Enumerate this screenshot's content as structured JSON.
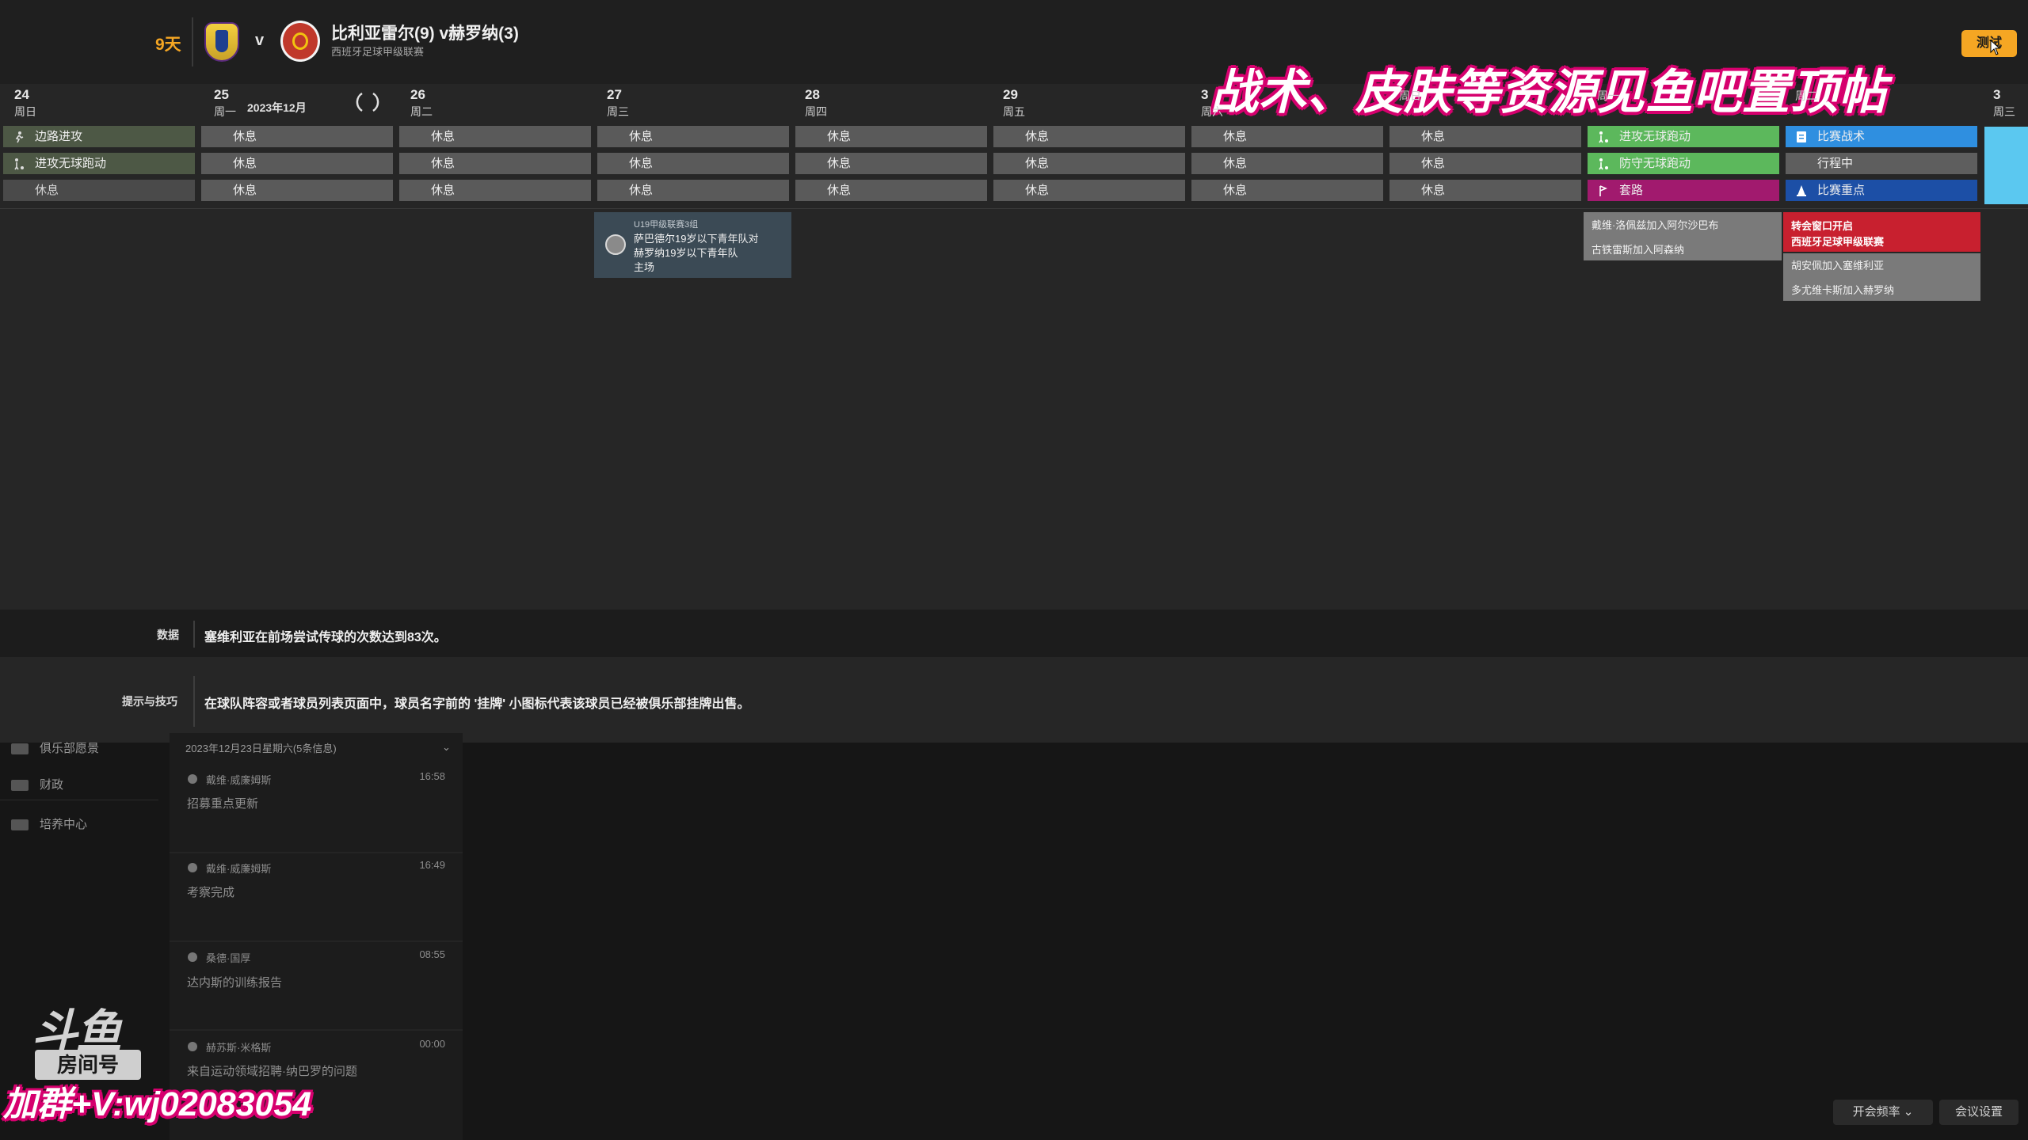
{
  "header": {
    "days_left": "9天",
    "vs": "v",
    "match_title": "比利亚雷尔(9) v赫罗纳(3)",
    "league": "西班牙足球甲级联赛",
    "continue_label": "测试"
  },
  "banner": "战术、皮肤等资源见鱼吧置顶帖",
  "calendar": {
    "month": "2023年12月",
    "days": [
      {
        "num": "24",
        "weekday": "周日"
      },
      {
        "num": "25",
        "weekday": "周一"
      },
      {
        "num": "26",
        "weekday": "周二"
      },
      {
        "num": "27",
        "weekday": "周三"
      },
      {
        "num": "28",
        "weekday": "周四"
      },
      {
        "num": "29",
        "weekday": "周五"
      },
      {
        "num": "3",
        "weekday": "周六"
      },
      {
        "num": "",
        "weekday": "周日"
      },
      {
        "num": "",
        "weekday": "周一"
      },
      {
        "num": "",
        "weekday": "周二"
      },
      {
        "num": "3",
        "weekday": "周三"
      }
    ],
    "rest": "休息",
    "first_col": [
      "边路进攻",
      "进攻无球跑动",
      "休息"
    ],
    "mon_col": [
      "进攻无球跑动",
      "防守无球跑动",
      "套路"
    ],
    "tue_col": [
      "比赛战术",
      "行程中",
      "比赛重点"
    ],
    "colors": {
      "green": "#5cb85c",
      "blue": "#2f8fe0",
      "dark_blue": "#1c4fa6",
      "purple": "#a11a6e",
      "transfer_red": "#c8202f",
      "accent": "#f5a623"
    }
  },
  "u19": {
    "title": "U19甲级联赛3组",
    "line1": "萨巴德尔19岁以下青年队对",
    "line2": "赫罗纳19岁以下青年队",
    "line3": "主场"
  },
  "news_mon": [
    "戴维·洛佩兹加入阿尔沙巴布",
    "古铁雷斯加入阿森纳"
  ],
  "transfer": {
    "line1": "转会窗口开启",
    "line2": "西班牙足球甲级联赛"
  },
  "news_tue": [
    "胡安佩加入塞维利亚",
    "多尤维卡斯加入赫罗纳"
  ],
  "data_strip": {
    "label": "数据",
    "text": "塞维利亚在前场尝试传球的次数达到83次。"
  },
  "tips_strip": {
    "label": "提示与技巧",
    "text": "在球队阵容或者球员列表页面中，球员名字前的 '挂牌' 小图标代表该球员已经被俱乐部挂牌出售。"
  },
  "sidebar": [
    "俱乐部愿景",
    "财政",
    "培养中心"
  ],
  "inbox": {
    "date": "2023年12月23日星期六(5条信息)",
    "messages": [
      {
        "sender": "戴维·威廉姆斯",
        "time": "16:58",
        "body": "招募重点更新"
      },
      {
        "sender": "戴维·威廉姆斯",
        "time": "16:49",
        "body": "考察完成"
      },
      {
        "sender": "桑德·国厚",
        "time": "08:55",
        "body": "达内斯的训练报告"
      },
      {
        "sender": "赫苏斯·米格斯",
        "time": "00:00",
        "body": "来自运动领域招聘·纳巴罗的问题"
      }
    ]
  },
  "watermark": {
    "logo": "斗鱼",
    "room": "房间号",
    "contact": "加群+V:wj02083054"
  },
  "footer": {
    "frequency": "开会频率",
    "settings": "会议设置"
  }
}
